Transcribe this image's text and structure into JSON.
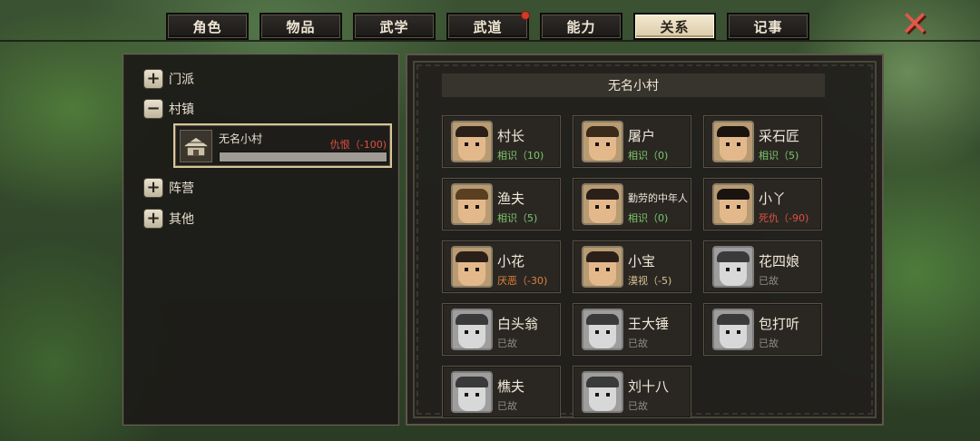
{
  "tabs": [
    {
      "label": "角色",
      "active": false,
      "badge": false
    },
    {
      "label": "物品",
      "active": false,
      "badge": false
    },
    {
      "label": "武学",
      "active": false,
      "badge": false
    },
    {
      "label": "武道",
      "active": false,
      "badge": true
    },
    {
      "label": "能力",
      "active": false,
      "badge": false
    },
    {
      "label": "关系",
      "active": true,
      "badge": false
    },
    {
      "label": "记事",
      "active": false,
      "badge": false
    }
  ],
  "close_icon": "✕",
  "tree": {
    "sect": {
      "icon": "+",
      "label": "门派"
    },
    "village": {
      "icon": "−",
      "label": "村镇"
    },
    "faction": {
      "icon": "+",
      "label": "阵营"
    },
    "other": {
      "icon": "+",
      "label": "其他"
    }
  },
  "village_card": {
    "name": "无名小村",
    "status": "仇恨（-100)",
    "status_color": "#e05040",
    "icon": "house-icon"
  },
  "region": {
    "title": "无名小村"
  },
  "npcs": [
    {
      "name": "村长",
      "status": "相识（10)",
      "color": "#7ec86a",
      "dead": false
    },
    {
      "name": "屠户",
      "status": "相识（0)",
      "color": "#7ec86a",
      "dead": false
    },
    {
      "name": "采石匠",
      "status": "相识（5)",
      "color": "#7ec86a",
      "dead": false
    },
    {
      "name": "渔夫",
      "status": "相识（5)",
      "color": "#7ec86a",
      "dead": false
    },
    {
      "name": "勤劳的中年人",
      "status": "相识（0)",
      "color": "#7ec86a",
      "dead": false
    },
    {
      "name": "小丫",
      "status": "死仇（-90)",
      "color": "#e05040",
      "dead": false
    },
    {
      "name": "小花",
      "status": "厌恶（-30)",
      "color": "#e0803a",
      "dead": false
    },
    {
      "name": "小宝",
      "status": "漠视（-5)",
      "color": "#d9c090",
      "dead": false
    },
    {
      "name": "花四娘",
      "status": "已故",
      "color": "#8a8a8a",
      "dead": true
    },
    {
      "name": "白头翁",
      "status": "已故",
      "color": "#8a8a8a",
      "dead": true
    },
    {
      "name": "王大锤",
      "status": "已故",
      "color": "#8a8a8a",
      "dead": true
    },
    {
      "name": "包打听",
      "status": "已故",
      "color": "#8a8a8a",
      "dead": true
    },
    {
      "name": "樵夫",
      "status": "已故",
      "color": "#8a8a8a",
      "dead": true
    },
    {
      "name": "刘十八",
      "status": "已故",
      "color": "#8a8a8a",
      "dead": true
    }
  ]
}
